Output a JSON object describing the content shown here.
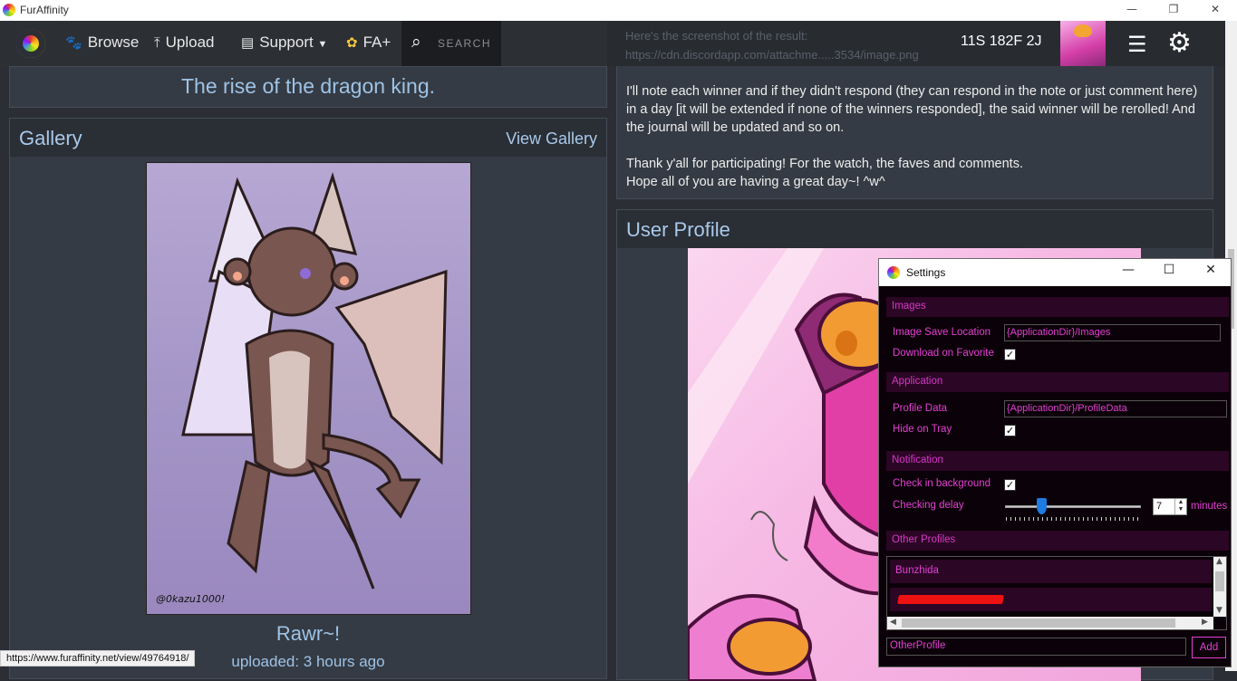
{
  "window": {
    "title": "FurAffinity"
  },
  "nav": {
    "browse": "Browse",
    "upload": "Upload",
    "support": "Support",
    "faplus": "FA+",
    "search_placeholder": "SEARCH",
    "notifications": "11S 182F 2J"
  },
  "journal": {
    "faded_line1": "Here's the screenshot of the result:",
    "faded_line2": "https://cdn.discordapp.com/attachme.....3534/image.png",
    "para1": "I'll note each winner and if they didn't respond (they can respond in the note or just comment here) in a day [it will be extended if none of the winners responded], the said winner will be rerolled! And the journal will be updated and so on.",
    "para2_line1": "Thank y'all for participating! For the watch, the faves and comments.",
    "para2_line2": "Hope all of you are having a great day~! ^w^"
  },
  "left": {
    "submission_title": "The rise of the dragon king.",
    "gallery_header": "Gallery",
    "view_gallery": "View Gallery",
    "gallery_watermark": "@0kazu1000!",
    "caption": "Rawr~!",
    "uploaded": "uploaded: 3 hours ago"
  },
  "profile": {
    "header": "User Profile"
  },
  "status_url": "https://www.furaffinity.net/view/49764918/",
  "settings": {
    "title": "Settings",
    "sections": {
      "images": "Images",
      "application": "Application",
      "notification": "Notification",
      "other_profiles": "Other Profiles"
    },
    "image_save_location_label": "Image Save Location",
    "image_save_location_value": "{ApplicationDir}/Images",
    "download_on_favorite_label": "Download on Favorite",
    "download_on_favorite": true,
    "profile_data_label": "Profile Data",
    "profile_data_value": "{ApplicationDir}/ProfileData",
    "hide_on_tray_label": "Hide on Tray",
    "hide_on_tray": true,
    "check_background_label": "Check in background",
    "check_background": true,
    "checking_delay_label": "Checking delay",
    "checking_delay_value": "7",
    "minutes_label": "minutes",
    "profiles": [
      "Bunzhida"
    ],
    "other_profile_input": "OtherProfile",
    "add_label": "Add"
  },
  "colors": {
    "settings_accent": "#e241d3",
    "link_blue": "#9ec3e6"
  }
}
